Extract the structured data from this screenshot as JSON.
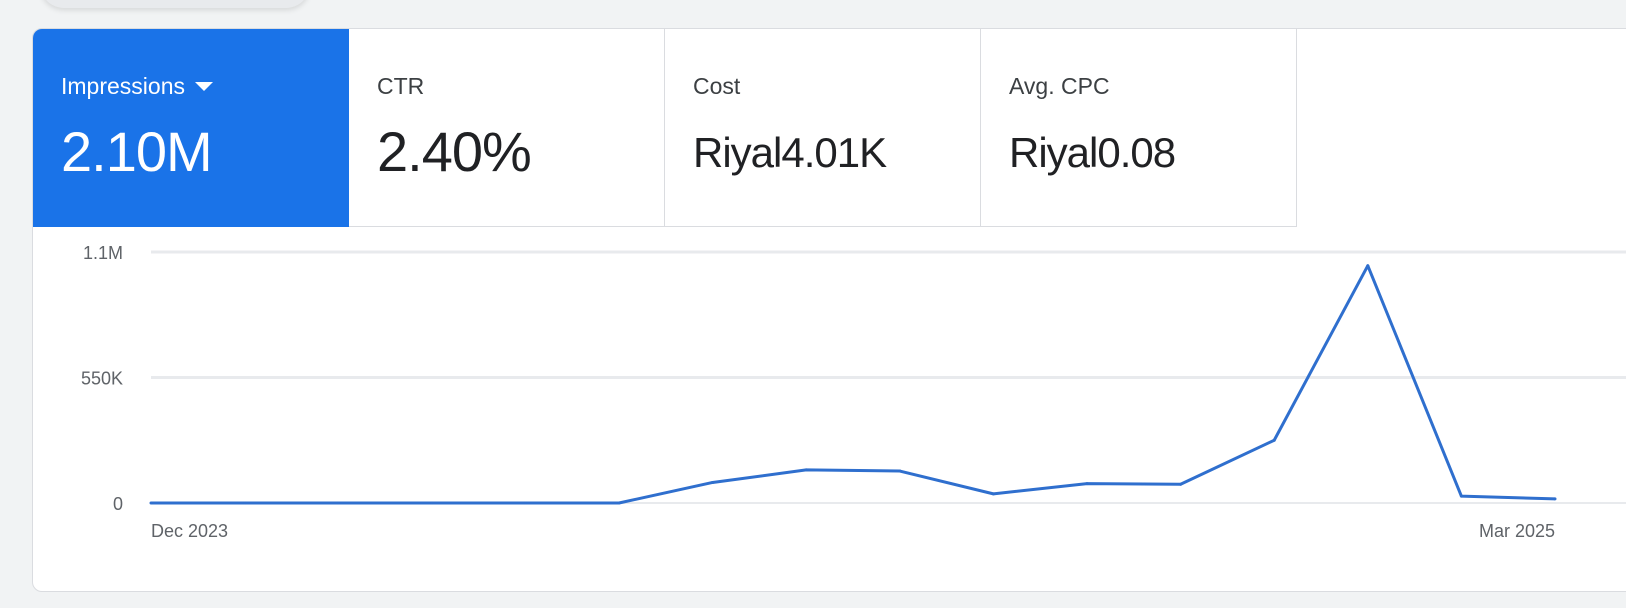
{
  "metrics": [
    {
      "label": "Impressions",
      "value": "2.10M",
      "selected": true
    },
    {
      "label": "CTR",
      "value": "2.40%"
    },
    {
      "label": "Cost",
      "value": "Riyal4.01K"
    },
    {
      "label": "Avg. CPC",
      "value": "Riyal0.08"
    }
  ],
  "colors": {
    "accent": "#1a73e8",
    "line": "#2f6fce",
    "grid": "#e8eaed"
  },
  "chart_data": {
    "type": "line",
    "series": [
      {
        "values": [
          0,
          0,
          0,
          0,
          0,
          0,
          90000,
          145000,
          140000,
          40000,
          85000,
          82000,
          275000,
          1040000,
          30000,
          18000
        ]
      }
    ],
    "x_range": [
      "Dec 2023",
      "Mar 2025"
    ],
    "xticks": [
      "Dec 2023",
      "Mar 2025"
    ],
    "yticks": [
      "0",
      "550K",
      "1.1M"
    ],
    "ylim": [
      0,
      1100000
    ],
    "grid": true
  }
}
